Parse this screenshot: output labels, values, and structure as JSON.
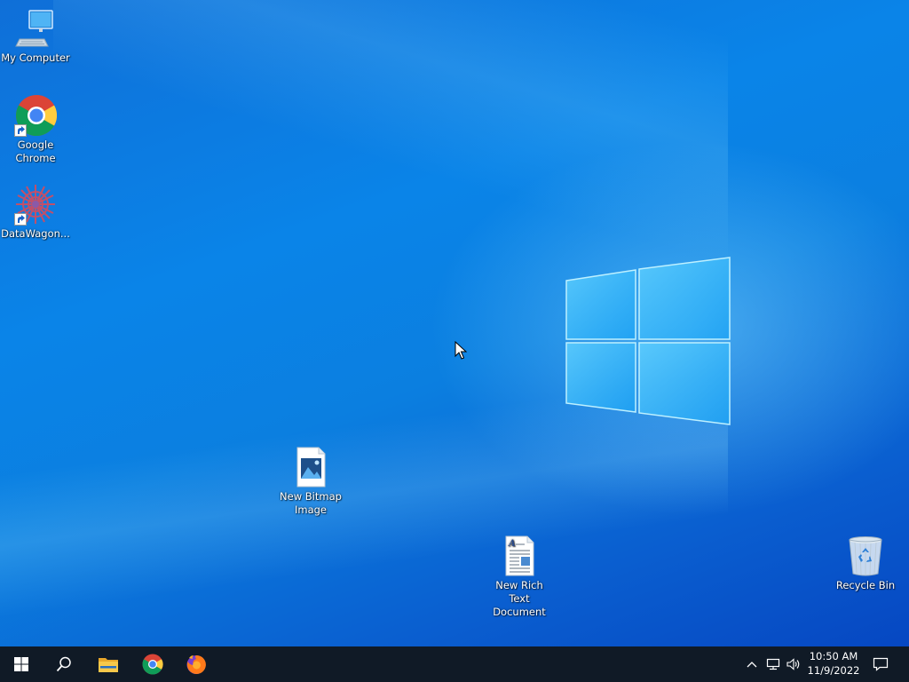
{
  "desktop": {
    "icons": [
      {
        "label": "My Computer",
        "icon": "computer-icon"
      },
      {
        "label": "Google Chrome",
        "icon": "chrome-icon"
      },
      {
        "label": "DataWagon...",
        "icon": "datawagon-icon"
      },
      {
        "label": "New Bitmap Image",
        "icon": "bitmap-file-icon"
      },
      {
        "label": "New Rich Text Document",
        "icon": "rich-text-file-icon"
      },
      {
        "label": "Recycle Bin",
        "icon": "recycle-bin-icon"
      }
    ]
  },
  "taskbar": {
    "start": "windows-logo-icon",
    "search": "search-icon",
    "pinned": [
      {
        "name": "File Explorer",
        "icon": "folder-icon"
      },
      {
        "name": "Google Chrome",
        "icon": "chrome-icon"
      },
      {
        "name": "Firefox",
        "icon": "firefox-icon"
      }
    ],
    "tray": {
      "chevron": "chevron-up-icon",
      "network": "network-icon",
      "volume": "volume-icon",
      "time": "10:50 AM",
      "date": "11/9/2022",
      "notifications": "notification-icon"
    }
  },
  "colors": {
    "wallpaper": "#0a84e8",
    "taskbar": "#101a26"
  }
}
